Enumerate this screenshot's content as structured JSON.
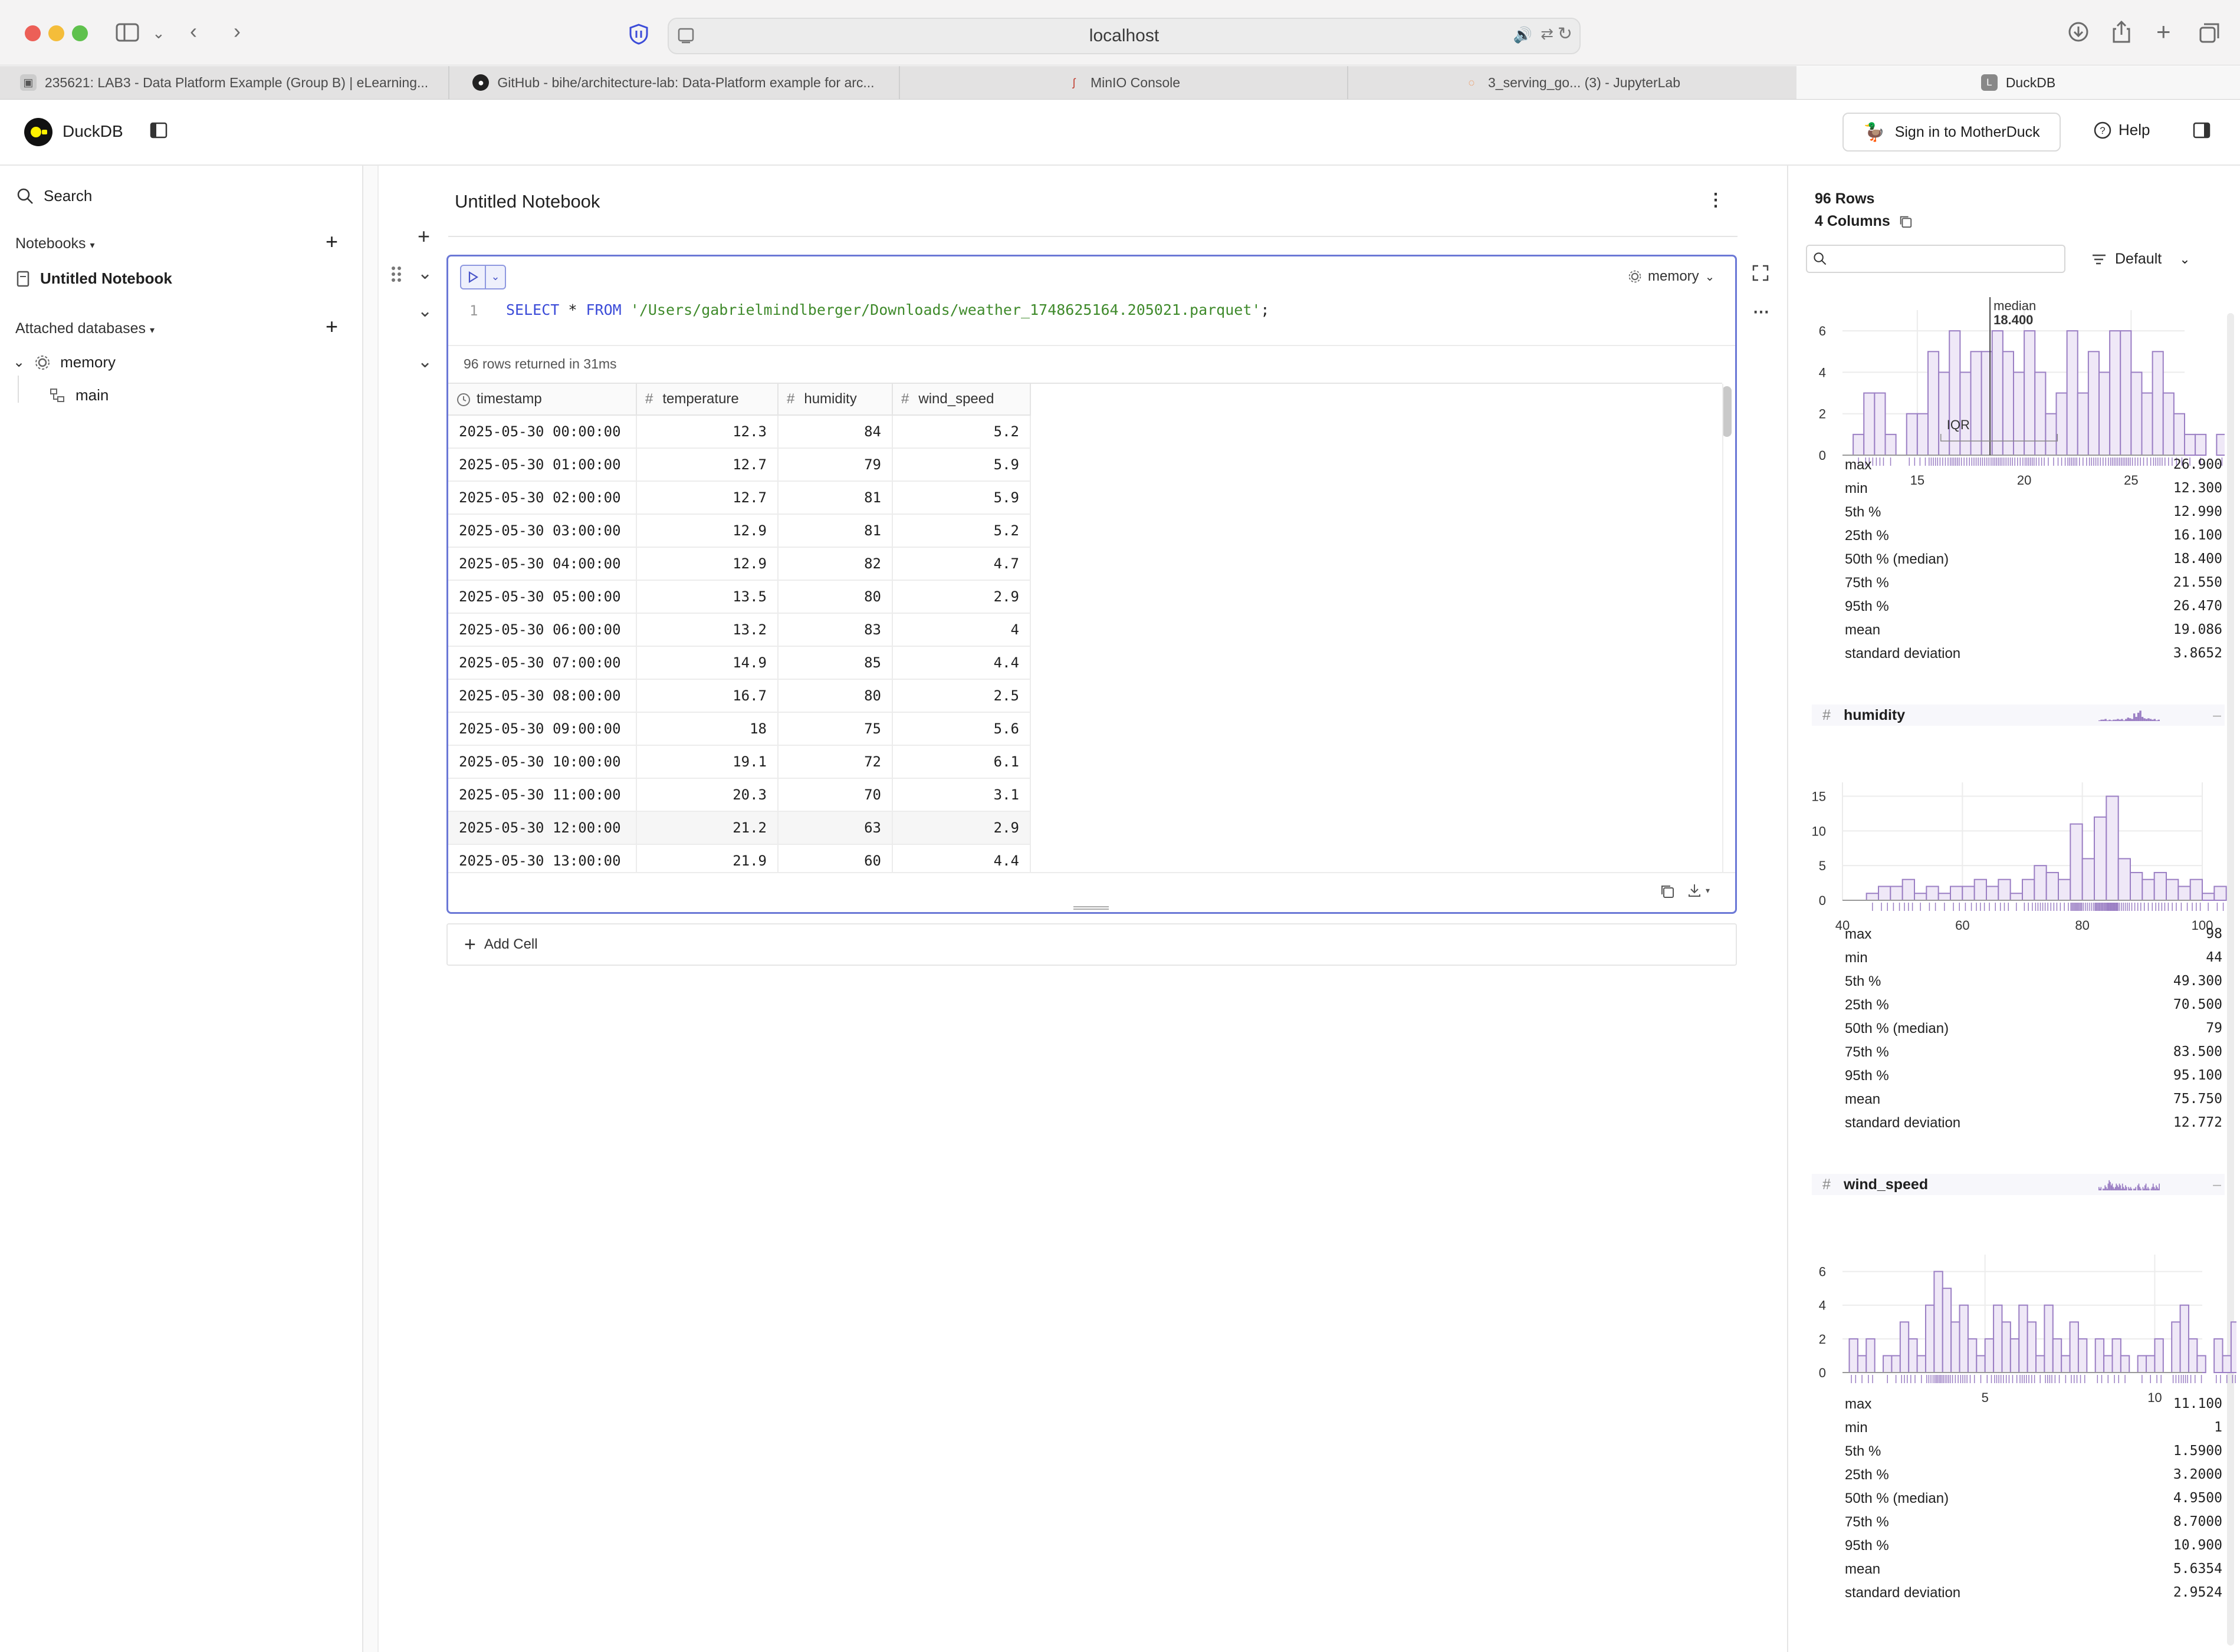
{
  "browser": {
    "url": "localhost",
    "tabs": [
      {
        "title": "235621: LAB3 - Data Platform Example (Group B) | eLearning...",
        "icon": "elearning-icon"
      },
      {
        "title": "GitHub - bihe/architecture-lab: Data-Platform example for arc...",
        "icon": "github-icon"
      },
      {
        "title": "MinIO Console",
        "icon": "minio-icon"
      },
      {
        "title": "3_serving_go... (3) - JupyterLab",
        "icon": "jupyter-icon"
      },
      {
        "title": "DuckDB",
        "icon": "duckdb-tab-icon",
        "badge": "L"
      }
    ]
  },
  "app": {
    "name": "DuckDB",
    "signin_label": "Sign in to MotherDuck",
    "help_label": "Help"
  },
  "sidebar": {
    "search_label": "Search",
    "notebooks_label": "Notebooks",
    "notebooks": [
      "Untitled Notebook"
    ],
    "attached_label": "Attached databases",
    "databases": [
      {
        "name": "memory",
        "schemas": [
          "main"
        ]
      }
    ]
  },
  "notebook": {
    "title": "Untitled Notebook",
    "cell": {
      "line_number": "1",
      "sql": {
        "kw1": "SELECT",
        "star": "*",
        "kw2": "FROM",
        "path": "'/Users/gabrielmindlberger/Downloads/weather_1748625164.205021.parquet'",
        "semi": ";"
      },
      "database": "memory",
      "status": "96 rows returned in 31ms",
      "columns": [
        {
          "name": "timestamp",
          "type_icon": "clock-icon"
        },
        {
          "name": "temperature",
          "type_icon": "#"
        },
        {
          "name": "humidity",
          "type_icon": "#"
        },
        {
          "name": "wind_speed",
          "type_icon": "#"
        }
      ],
      "rows": [
        [
          "2025-05-30 00:00:00",
          "12.3",
          "84",
          "5.2"
        ],
        [
          "2025-05-30 01:00:00",
          "12.7",
          "79",
          "5.9"
        ],
        [
          "2025-05-30 02:00:00",
          "12.7",
          "81",
          "5.9"
        ],
        [
          "2025-05-30 03:00:00",
          "12.9",
          "81",
          "5.2"
        ],
        [
          "2025-05-30 04:00:00",
          "12.9",
          "82",
          "4.7"
        ],
        [
          "2025-05-30 05:00:00",
          "13.5",
          "80",
          "2.9"
        ],
        [
          "2025-05-30 06:00:00",
          "13.2",
          "83",
          "4"
        ],
        [
          "2025-05-30 07:00:00",
          "14.9",
          "85",
          "4.4"
        ],
        [
          "2025-05-30 08:00:00",
          "16.7",
          "80",
          "2.5"
        ],
        [
          "2025-05-30 09:00:00",
          "18",
          "75",
          "5.6"
        ],
        [
          "2025-05-30 10:00:00",
          "19.1",
          "72",
          "6.1"
        ],
        [
          "2025-05-30 11:00:00",
          "20.3",
          "70",
          "3.1"
        ],
        [
          "2025-05-30 12:00:00",
          "21.2",
          "63",
          "2.9"
        ],
        [
          "2025-05-30 13:00:00",
          "21.9",
          "60",
          "4.4"
        ]
      ]
    },
    "add_cell_label": "Add Cell"
  },
  "summary": {
    "rows_label": "96 Rows",
    "columns_label": "4 Columns",
    "search_placeholder": "",
    "sort_label": "Default",
    "columns": [
      {
        "name": "temperature",
        "median_label": "median",
        "median_value": "18.400",
        "iqr_label": "IQR",
        "histogram": {
          "x_ticks": [
            "15",
            "20",
            "25"
          ],
          "x_tick_values": [
            15,
            20,
            25
          ],
          "x_range": [
            11.5,
            27.5
          ],
          "y_ticks": [
            "0",
            "2",
            "4",
            "6"
          ],
          "y_max": 7,
          "bin_width": 0.5,
          "bin_start": 12,
          "counts": [
            1,
            3,
            3,
            1,
            0,
            2,
            2,
            5,
            4,
            6,
            4,
            5,
            5,
            6,
            5,
            4,
            6,
            4,
            2,
            3,
            6,
            3,
            5,
            4,
            6,
            6,
            4,
            3,
            5,
            3,
            2,
            1,
            1,
            0,
            1,
            2,
            3,
            4,
            5
          ]
        },
        "stats": [
          {
            "label": "max",
            "value": "26.900"
          },
          {
            "label": "min",
            "value": "12.300"
          },
          {
            "label": "5th %",
            "value": "12.990"
          },
          {
            "label": "25th %",
            "value": "16.100"
          },
          {
            "label": "50th % (median)",
            "value": "18.400"
          },
          {
            "label": "75th %",
            "value": "21.550"
          },
          {
            "label": "95th %",
            "value": "26.470"
          },
          {
            "label": "mean",
            "value": "19.086"
          },
          {
            "label": "standard deviation",
            "value": "3.8652"
          }
        ]
      },
      {
        "name": "humidity",
        "histogram": {
          "x_ticks": [
            "40",
            "60",
            "80",
            "100"
          ],
          "x_tick_values": [
            40,
            60,
            80,
            100
          ],
          "x_range": [
            40,
            100
          ],
          "y_ticks": [
            "0",
            "5",
            "10",
            "15"
          ],
          "y_max": 17,
          "bin_width": 2,
          "bin_start": 44,
          "counts": [
            1,
            2,
            2,
            3,
            1,
            2,
            1,
            2,
            2,
            3,
            2,
            3,
            1,
            3,
            5,
            4,
            3,
            11,
            6,
            12,
            15,
            6,
            4,
            3,
            4,
            3,
            2,
            3,
            1,
            2
          ]
        },
        "stats": [
          {
            "label": "max",
            "value": "98"
          },
          {
            "label": "min",
            "value": "44"
          },
          {
            "label": "5th %",
            "value": "49.300"
          },
          {
            "label": "25th %",
            "value": "70.500"
          },
          {
            "label": "50th % (median)",
            "value": "79"
          },
          {
            "label": "75th %",
            "value": "83.500"
          },
          {
            "label": "95th %",
            "value": "95.100"
          },
          {
            "label": "mean",
            "value": "75.750"
          },
          {
            "label": "standard deviation",
            "value": "12.772"
          }
        ]
      },
      {
        "name": "wind_speed",
        "histogram": {
          "x_ticks": [
            "5",
            "10"
          ],
          "x_tick_values": [
            5,
            10
          ],
          "x_range": [
            0.8,
            11.4
          ],
          "y_ticks": [
            "0",
            "2",
            "4",
            "6"
          ],
          "y_max": 7,
          "bin_width": 0.25,
          "bin_start": 1,
          "counts": [
            2,
            1,
            2,
            0,
            1,
            1,
            3,
            2,
            1,
            4,
            6,
            5,
            3,
            4,
            2,
            1,
            2,
            4,
            3,
            2,
            4,
            3,
            1,
            4,
            2,
            1,
            3,
            2,
            0,
            2,
            1,
            2,
            1,
            0,
            1,
            1,
            2,
            0,
            3,
            4,
            2,
            1,
            0,
            2,
            1,
            3,
            4,
            1,
            2,
            1,
            0,
            1,
            2,
            4,
            2,
            1,
            3,
            2,
            1,
            4
          ]
        },
        "stats": [
          {
            "label": "max",
            "value": "11.100"
          },
          {
            "label": "min",
            "value": "1"
          },
          {
            "label": "5th %",
            "value": "1.5900"
          },
          {
            "label": "25th %",
            "value": "3.2000"
          },
          {
            "label": "50th % (median)",
            "value": "4.9500"
          },
          {
            "label": "75th %",
            "value": "8.7000"
          },
          {
            "label": "95th %",
            "value": "10.900"
          },
          {
            "label": "mean",
            "value": "5.6354"
          },
          {
            "label": "standard deviation",
            "value": "2.9524"
          }
        ]
      }
    ]
  },
  "colors": {
    "accent": "#6b78d6",
    "histogram": "#9b7fc4",
    "histogram_fill": "#efe8f7",
    "keyword": "#3b4bd8",
    "string": "#3f8a2b"
  }
}
